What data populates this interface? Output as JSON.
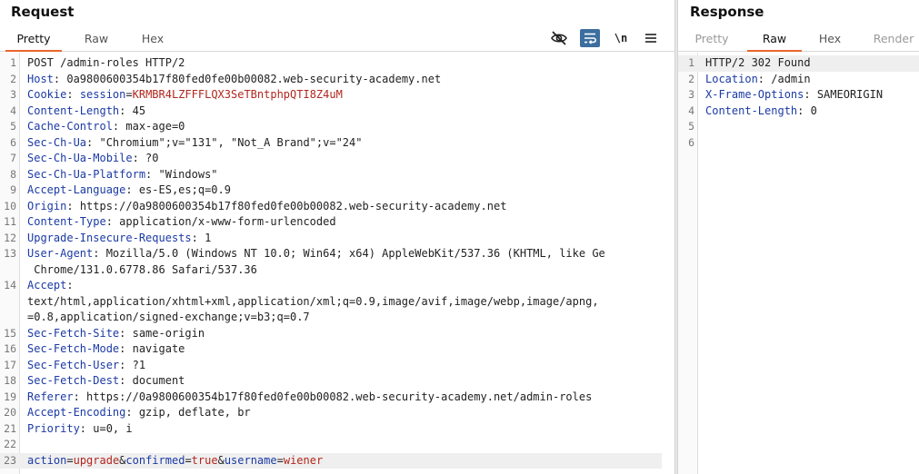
{
  "request": {
    "title": "Request",
    "tabs": [
      {
        "label": "Pretty",
        "state": "active"
      },
      {
        "label": "Raw",
        "state": "normal"
      },
      {
        "label": "Hex",
        "state": "normal"
      }
    ],
    "toolbar": {
      "icons": [
        "eye-slash-icon",
        "word-wrap-icon",
        "newline-icon",
        "menu-icon"
      ],
      "newline_label": "\\n"
    },
    "lines": [
      {
        "n": "1",
        "name": "",
        "value": "POST /admin-roles HTTP/2"
      },
      {
        "n": "2",
        "name": "Host",
        "value": "0a9800600354b17f80fed0fe00b00082.web-security-academy.net"
      },
      {
        "n": "3",
        "name": "Cookie",
        "value": "",
        "cookie_name": "session",
        "cookie_value": "KRMBR4LZFFFLQX3SeTBntphpQTI8Z4uM"
      },
      {
        "n": "4",
        "name": "Content-Length",
        "value": "45"
      },
      {
        "n": "5",
        "name": "Cache-Control",
        "value": "max-age=0"
      },
      {
        "n": "6",
        "name": "Sec-Ch-Ua",
        "value": "\"Chromium\";v=\"131\", \"Not_A Brand\";v=\"24\""
      },
      {
        "n": "7",
        "name": "Sec-Ch-Ua-Mobile",
        "value": "?0"
      },
      {
        "n": "8",
        "name": "Sec-Ch-Ua-Platform",
        "value": "\"Windows\""
      },
      {
        "n": "9",
        "name": "Accept-Language",
        "value": "es-ES,es;q=0.9"
      },
      {
        "n": "10",
        "name": "Origin",
        "value": "https://0a9800600354b17f80fed0fe00b00082.web-security-academy.net"
      },
      {
        "n": "11",
        "name": "Content-Type",
        "value": "application/x-www-form-urlencoded"
      },
      {
        "n": "12",
        "name": "Upgrade-Insecure-Requests",
        "value": "1"
      },
      {
        "n": "13",
        "name": "User-Agent",
        "value": "Mozilla/5.0 (Windows NT 10.0; Win64; x64) AppleWebKit/537.36 (KHTML, like Ge",
        "continuation": [
          " Chrome/131.0.6778.86 Safari/537.36"
        ]
      },
      {
        "n": "14",
        "name": "Accept",
        "value": "",
        "continuation": [
          "text/html,application/xhtml+xml,application/xml;q=0.9,image/avif,image/webp,image/apng,",
          "=0.8,application/signed-exchange;v=b3;q=0.7"
        ]
      },
      {
        "n": "15",
        "name": "Sec-Fetch-Site",
        "value": "same-origin"
      },
      {
        "n": "16",
        "name": "Sec-Fetch-Mode",
        "value": "navigate"
      },
      {
        "n": "17",
        "name": "Sec-Fetch-User",
        "value": "?1"
      },
      {
        "n": "18",
        "name": "Sec-Fetch-Dest",
        "value": "document"
      },
      {
        "n": "19",
        "name": "Referer",
        "value": "https://0a9800600354b17f80fed0fe00b00082.web-security-academy.net/admin-roles"
      },
      {
        "n": "20",
        "name": "Accept-Encoding",
        "value": "gzip, deflate, br"
      },
      {
        "n": "21",
        "name": "Priority",
        "value": "u=0, i"
      },
      {
        "n": "22",
        "name": "",
        "value": ""
      },
      {
        "n": "23",
        "name": "",
        "value": "",
        "body": [
          {
            "k": "action",
            "v": "upgrade"
          },
          {
            "k": "confirmed",
            "v": "true"
          },
          {
            "k": "username",
            "v": "wiener"
          }
        ]
      }
    ]
  },
  "response": {
    "title": "Response",
    "tabs": [
      {
        "label": "Pretty",
        "state": "disabled"
      },
      {
        "label": "Raw",
        "state": "active"
      },
      {
        "label": "Hex",
        "state": "normal"
      },
      {
        "label": "Render",
        "state": "disabled"
      }
    ],
    "lines": [
      {
        "n": "1",
        "name": "",
        "value": "HTTP/2 302 Found"
      },
      {
        "n": "2",
        "name": "Location",
        "value": "/admin"
      },
      {
        "n": "3",
        "name": "X-Frame-Options",
        "value": "SAMEORIGIN"
      },
      {
        "n": "4",
        "name": "Content-Length",
        "value": "0"
      },
      {
        "n": "5",
        "name": "",
        "value": ""
      },
      {
        "n": "6",
        "name": "",
        "value": ""
      }
    ]
  },
  "colors": {
    "header_name": "#1b3aa5",
    "param_value": "#b3261e",
    "active_tab_underline": "#e8652c",
    "wrap_button_bg": "#3c6e9f"
  }
}
